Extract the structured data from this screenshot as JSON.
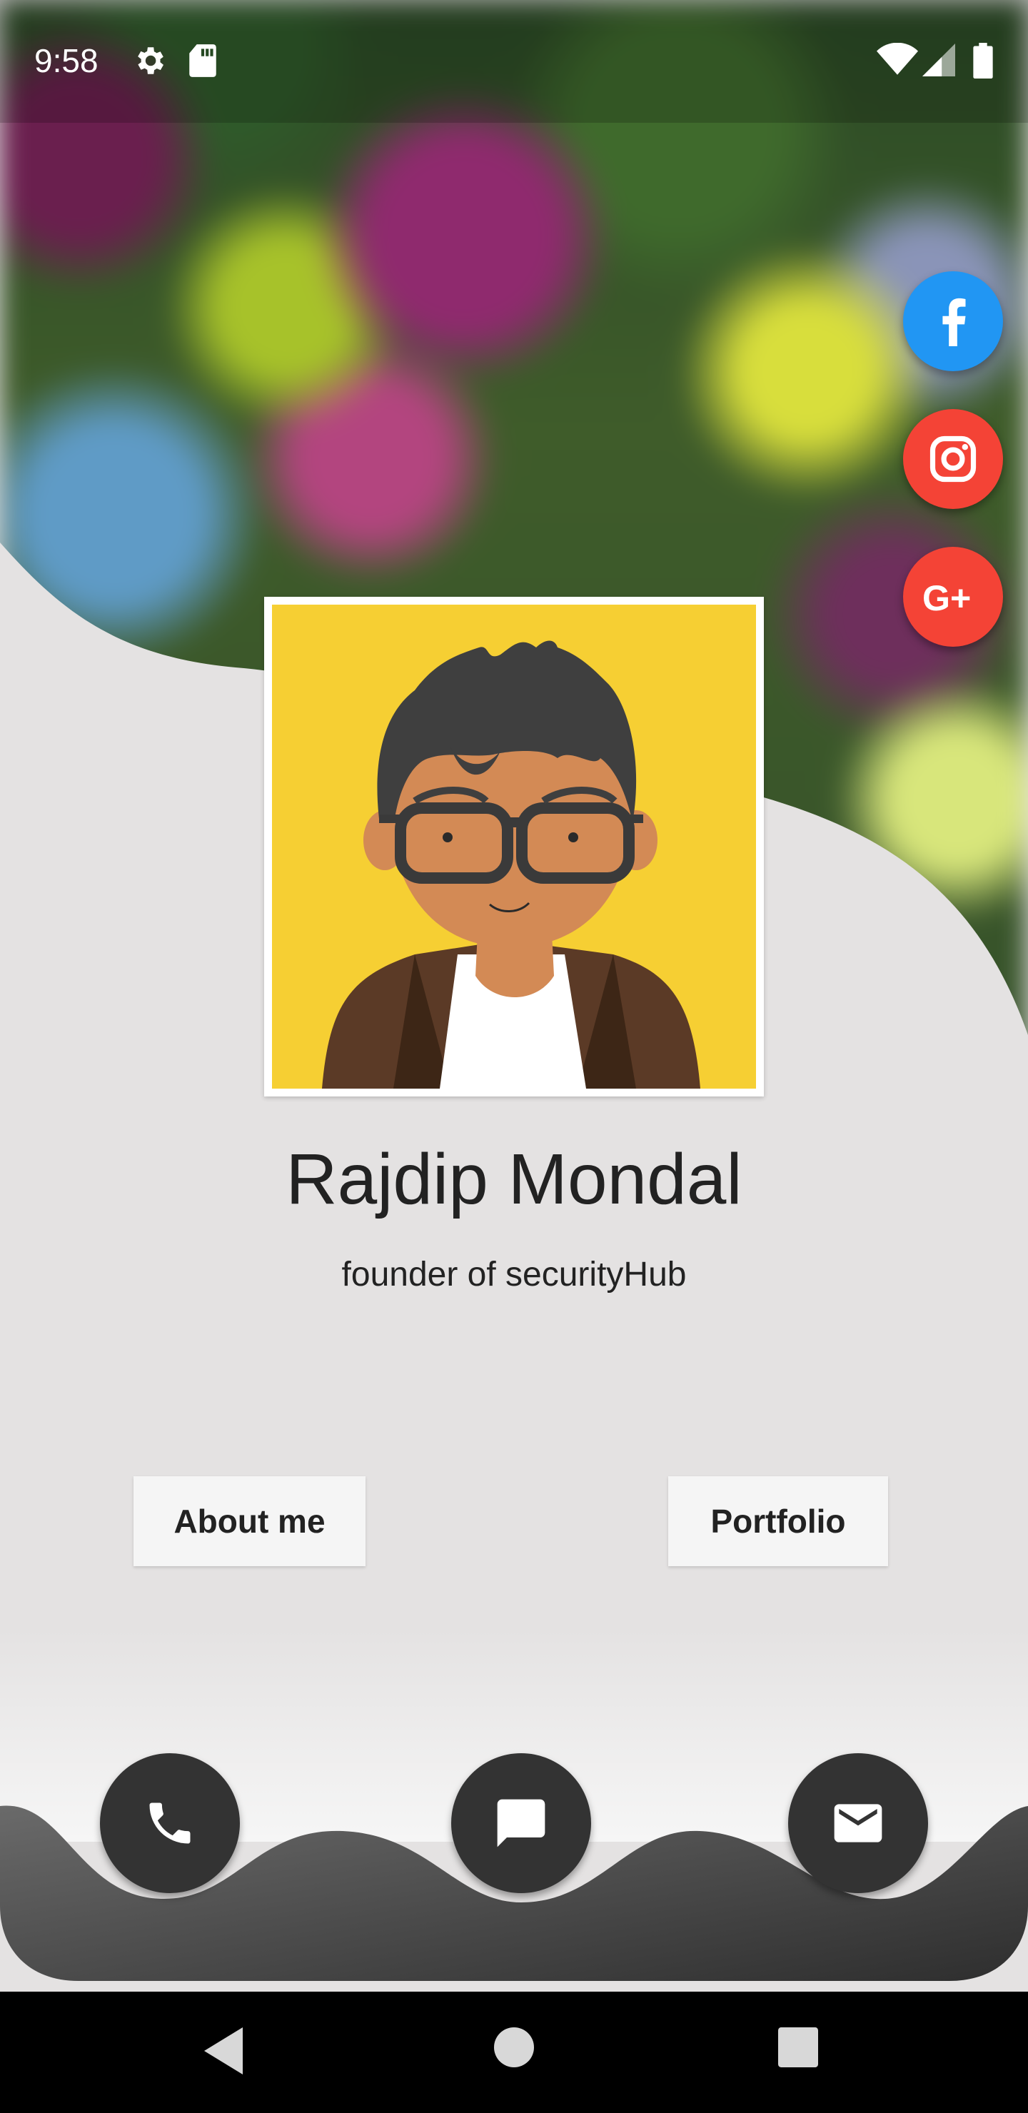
{
  "status_bar": {
    "time": "9:58",
    "icons": [
      "settings-icon",
      "sd-card-icon",
      "wifi-icon",
      "cell-signal-icon",
      "battery-icon"
    ]
  },
  "social": {
    "items": [
      {
        "name": "facebook",
        "icon": "facebook-icon",
        "color": "#2196f3"
      },
      {
        "name": "instagram",
        "icon": "instagram-icon",
        "color": "#f44336"
      },
      {
        "name": "google-plus",
        "icon": "google-plus-icon",
        "color": "#f44336"
      }
    ]
  },
  "profile": {
    "name": "Rajdip Mondal",
    "subtitle": "founder of securityHub",
    "avatar_bg": "#f6cf33"
  },
  "buttons": {
    "about": "About me",
    "portfolio": "Portfolio"
  },
  "actions": {
    "icons": [
      "phone-icon",
      "chat-icon",
      "mail-icon"
    ]
  },
  "nav": {
    "icons": [
      "back-icon",
      "home-icon",
      "recents-icon"
    ]
  },
  "colors": {
    "background": "#e4e2e2",
    "fab": "#333333",
    "wave": "#444444"
  }
}
